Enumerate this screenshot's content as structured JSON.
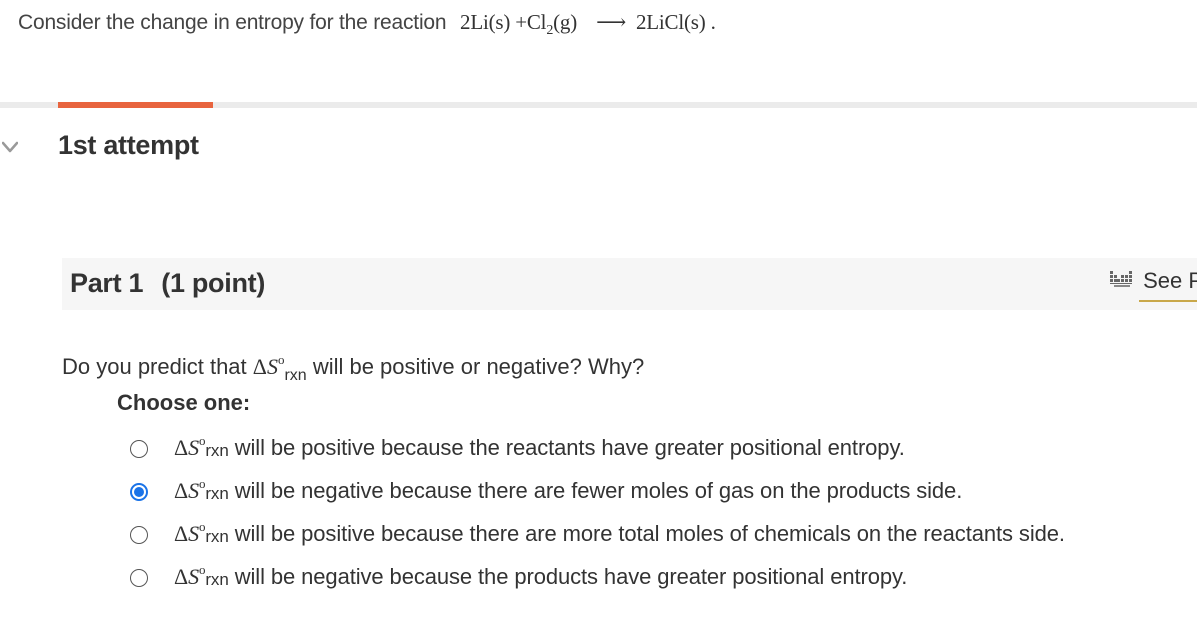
{
  "question": {
    "prefix": "Consider the change in entropy for the reaction",
    "equation": {
      "r1_coef": "2Li",
      "r1_state": "(s)",
      "plus": "+",
      "r2_formula": "Cl",
      "r2_sub": "2",
      "r2_state": "(g)",
      "arrow": "⟶",
      "p1_formula": "2LiCl",
      "p1_state": "(s)",
      "end": "."
    }
  },
  "progress": {
    "fraction_complete": 0.13
  },
  "attempt": {
    "label": "1st attempt",
    "expanded_icon": "chevron-down-icon"
  },
  "part": {
    "title": "Part 1",
    "points": "(1 point)",
    "see_periodic": "See P",
    "periodic_icon": "periodic-table-icon"
  },
  "prompt": {
    "before": "Do you predict that",
    "delta_symbol": "Δ",
    "s_symbol": "S",
    "degree": "o",
    "subscript": "rxn",
    "after": "will be positive or negative? Why?"
  },
  "choose_label": "Choose one:",
  "options": [
    {
      "delta": "Δ",
      "s": "S",
      "degree": "o",
      "sub": "rxn",
      "text": "will be positive because the reactants have greater positional entropy.",
      "selected": false
    },
    {
      "delta": "Δ",
      "s": "S",
      "degree": "o",
      "sub": "rxn",
      "text": "will be negative because there are fewer moles of gas on the products side.",
      "selected": true
    },
    {
      "delta": "Δ",
      "s": "S",
      "degree": "o",
      "sub": "rxn",
      "text": "will be positive because there are more total moles of chemicals on the reactants side.",
      "selected": false
    },
    {
      "delta": "Δ",
      "s": "S",
      "degree": "o",
      "sub": "rxn",
      "text": "will be negative because the products have greater positional entropy.",
      "selected": false
    }
  ],
  "colors": {
    "accent_progress": "#e8643e",
    "radio_selected": "#1a73e8",
    "link_underline": "#c9a84a"
  }
}
